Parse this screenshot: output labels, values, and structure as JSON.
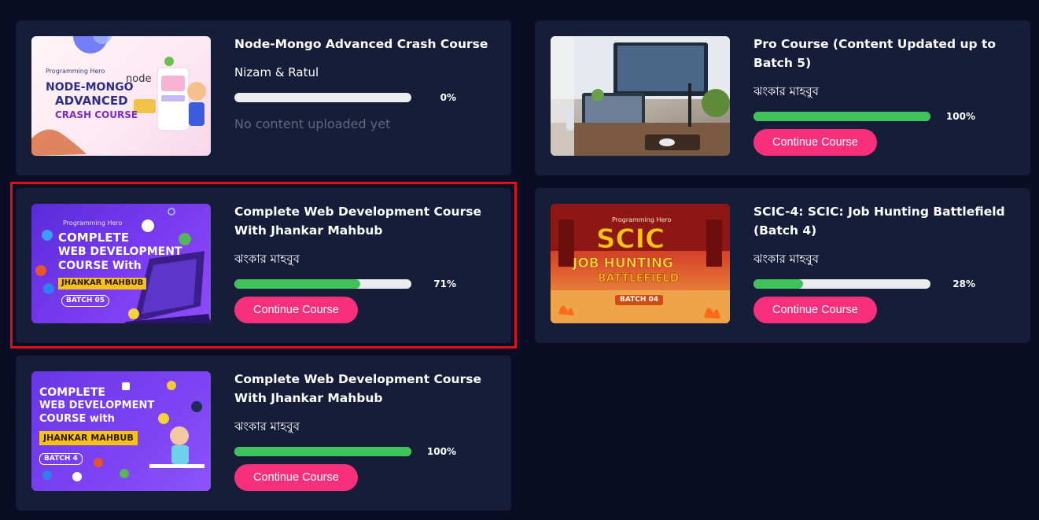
{
  "courses": [
    {
      "title": "Node-Mongo Advanced Crash Course",
      "author": "Nizam & Ratul",
      "progress_label": "0%",
      "progress": 0,
      "note": "No content uploaded yet",
      "thumb": {
        "brand": "Programming Hero",
        "lines": [
          "NODE-MONGO",
          "ADVANCED",
          "CRASH COURSE"
        ],
        "badge": "node"
      }
    },
    {
      "title": "Pro Course (Content Updated up to Batch 5)",
      "author": "ঝংকার মাহবুব",
      "progress_label": "100%",
      "progress": 100,
      "button": "Continue Course"
    },
    {
      "title": "Complete Web Development Course With Jhankar Mahbub",
      "author": "ঝংকার মাহবুব",
      "progress_label": "71%",
      "progress": 71,
      "button": "Continue Course",
      "thumb": {
        "brand": "Programming Hero",
        "lines": [
          "COMPLETE",
          "WEB DEVELOPMENT",
          "COURSE With"
        ],
        "name_tag": "JHANKAR MAHBUB",
        "batch": "BATCH 05"
      }
    },
    {
      "title": "SCIC-4: SCIC: Job Hunting Battlefield (Batch 4)",
      "author": "ঝংকার মাহবুব",
      "progress_label": "28%",
      "progress": 28,
      "button": "Continue Course",
      "thumb": {
        "brand": "Programming Hero",
        "lines": [
          "SCIC",
          "JOB HUNTING",
          "BATTLEFIELD"
        ],
        "batch": "BATCH 04"
      }
    },
    {
      "title": "Complete Web Development Course With Jhankar Mahbub",
      "author": "ঝংকার মাহবুব",
      "progress_label": "100%",
      "progress": 100,
      "button": "Continue Course",
      "thumb": {
        "lines": [
          "COMPLETE",
          "WEB DEVELOPMENT",
          "COURSE with"
        ],
        "name_tag": "JHANKAR MAHBUB",
        "batch": "BATCH 4"
      }
    }
  ],
  "colors": {
    "page_bg": "#0a0d23",
    "card_bg": "#161d38",
    "accent": "#f8307b",
    "progress_fill": "#3ec35a",
    "progress_track": "#ebecee",
    "highlight": "#e0101a"
  }
}
